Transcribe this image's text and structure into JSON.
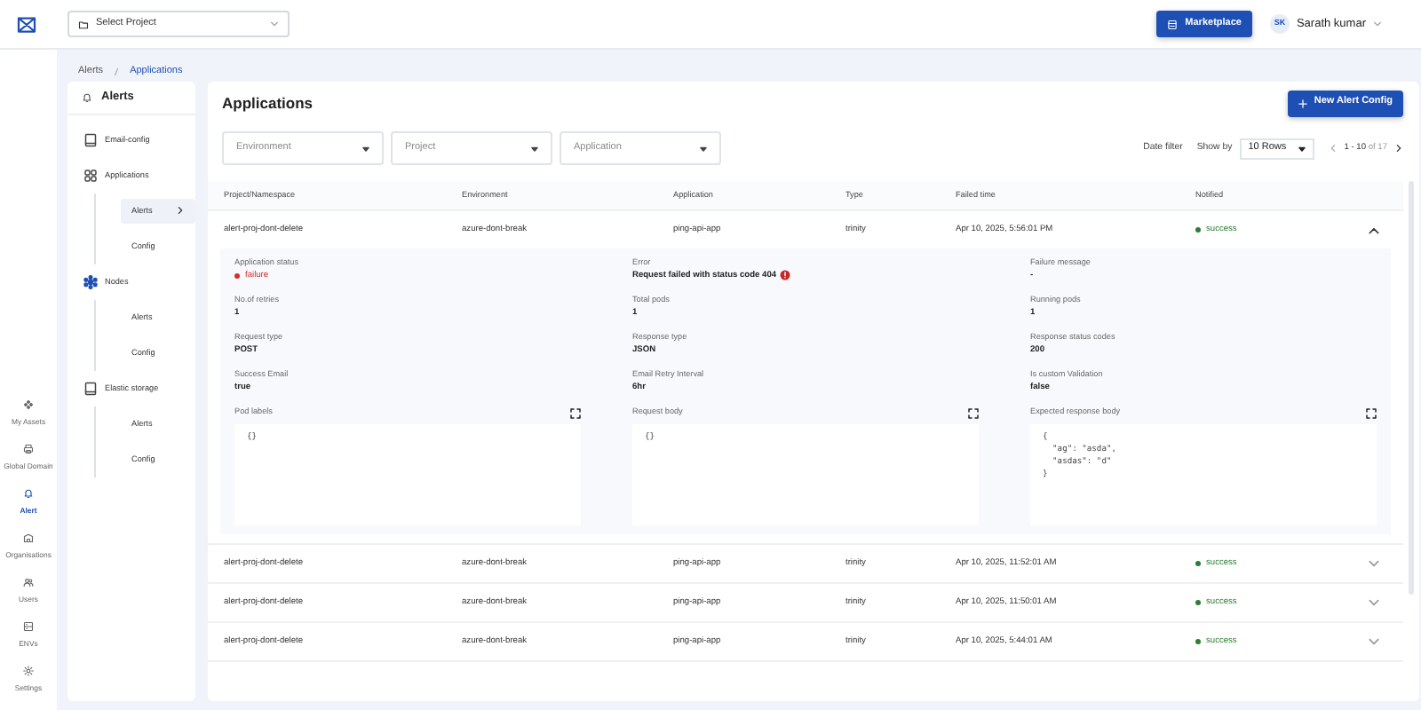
{
  "topbar": {
    "project_select": {
      "placeholder": "Select Project"
    },
    "marketplace_button": "Marketplace",
    "user": {
      "initials": "SK",
      "name": "Sarath kumar"
    }
  },
  "rail": [
    {
      "label": "My Assets",
      "selected": false
    },
    {
      "label": "Global Domain",
      "selected": false
    },
    {
      "label": "Alert",
      "selected": true
    },
    {
      "label": "Organisations",
      "selected": false
    },
    {
      "label": "Users",
      "selected": false
    },
    {
      "label": "ENVs",
      "selected": false
    },
    {
      "label": "Settings",
      "selected": false
    }
  ],
  "breadcrumb": [
    "Alerts",
    "Applications"
  ],
  "side_panel": {
    "title": "Alerts",
    "items": [
      {
        "label": "Email-config"
      },
      {
        "label": "Applications",
        "children": [
          {
            "label": "Alerts",
            "selected": true
          },
          {
            "label": "Config",
            "selected": false
          }
        ]
      },
      {
        "label": "Nodes",
        "children": [
          {
            "label": "Alerts",
            "selected": false
          },
          {
            "label": "Config",
            "selected": false
          }
        ]
      },
      {
        "label": "Elastic storage",
        "children": [
          {
            "label": "Alerts",
            "selected": false
          },
          {
            "label": "Config",
            "selected": false
          }
        ]
      }
    ]
  },
  "main": {
    "title": "Applications",
    "new_button": "New Alert Config",
    "filters": [
      {
        "placeholder": "Environment"
      },
      {
        "placeholder": "Project"
      },
      {
        "placeholder": "Application"
      }
    ],
    "date_filter": "Date filter",
    "show_by_label": "Show by",
    "rows_select": "10 Rows",
    "pager": {
      "range": "1 - 10",
      "total": "of 17"
    },
    "table": {
      "columns": [
        "Project/Namespace",
        "Environment",
        "Application",
        "Type",
        "Failed time",
        "Notified"
      ],
      "rows": [
        {
          "cells": [
            "alert-proj-dont-delete",
            "azure-dont-break",
            "ping-api-app",
            "trinity",
            "Apr 10, 2025, 5:56:01 PM"
          ],
          "notified": {
            "text": "success",
            "color": "#2e7d32"
          },
          "expanded": true,
          "details": {
            "fields": [
              {
                "label": "Application status",
                "value": "failure",
                "kind": "status",
                "color": "#d32f2f"
              },
              {
                "label": "Error",
                "value": "Request failed with status code 404",
                "kind": "error"
              },
              {
                "label": "Failure message",
                "value": "-",
                "kind": "text"
              },
              {
                "label": "No.of retries",
                "value": "1",
                "kind": "text"
              },
              {
                "label": "Total pods",
                "value": "1",
                "kind": "text"
              },
              {
                "label": "Running pods",
                "value": "1",
                "kind": "text"
              },
              {
                "label": "Request type",
                "value": "POST",
                "kind": "text"
              },
              {
                "label": "Response type",
                "value": "JSON",
                "kind": "text"
              },
              {
                "label": "Response status codes",
                "value": "200",
                "kind": "text"
              },
              {
                "label": "Success Email",
                "value": "true",
                "kind": "text"
              },
              {
                "label": "Email Retry Interval",
                "value": "6hr",
                "kind": "text"
              },
              {
                "label": "Is custom Validation",
                "value": "false",
                "kind": "text"
              }
            ],
            "boxes": [
              {
                "label": "Pod labels",
                "content": "{}"
              },
              {
                "label": "Request body",
                "content": "{}"
              },
              {
                "label": "Expected response body",
                "content": "{\n  \"ag\": \"asda\",\n  \"asdas\": \"d\"\n}"
              }
            ]
          }
        },
        {
          "cells": [
            "alert-proj-dont-delete",
            "azure-dont-break",
            "ping-api-app",
            "trinity",
            "Apr 10, 2025, 11:52:01 AM"
          ],
          "notified": {
            "text": "success",
            "color": "#2e7d32"
          },
          "expanded": false
        },
        {
          "cells": [
            "alert-proj-dont-delete",
            "azure-dont-break",
            "ping-api-app",
            "trinity",
            "Apr 10, 2025, 11:50:01 AM"
          ],
          "notified": {
            "text": "success",
            "color": "#2e7d32"
          },
          "expanded": false
        },
        {
          "cells": [
            "alert-proj-dont-delete",
            "azure-dont-break",
            "ping-api-app",
            "trinity",
            "Apr 10, 2025, 5:44:01 AM"
          ],
          "notified": {
            "text": "success",
            "color": "#2e7d32"
          },
          "expanded": false
        }
      ]
    }
  }
}
